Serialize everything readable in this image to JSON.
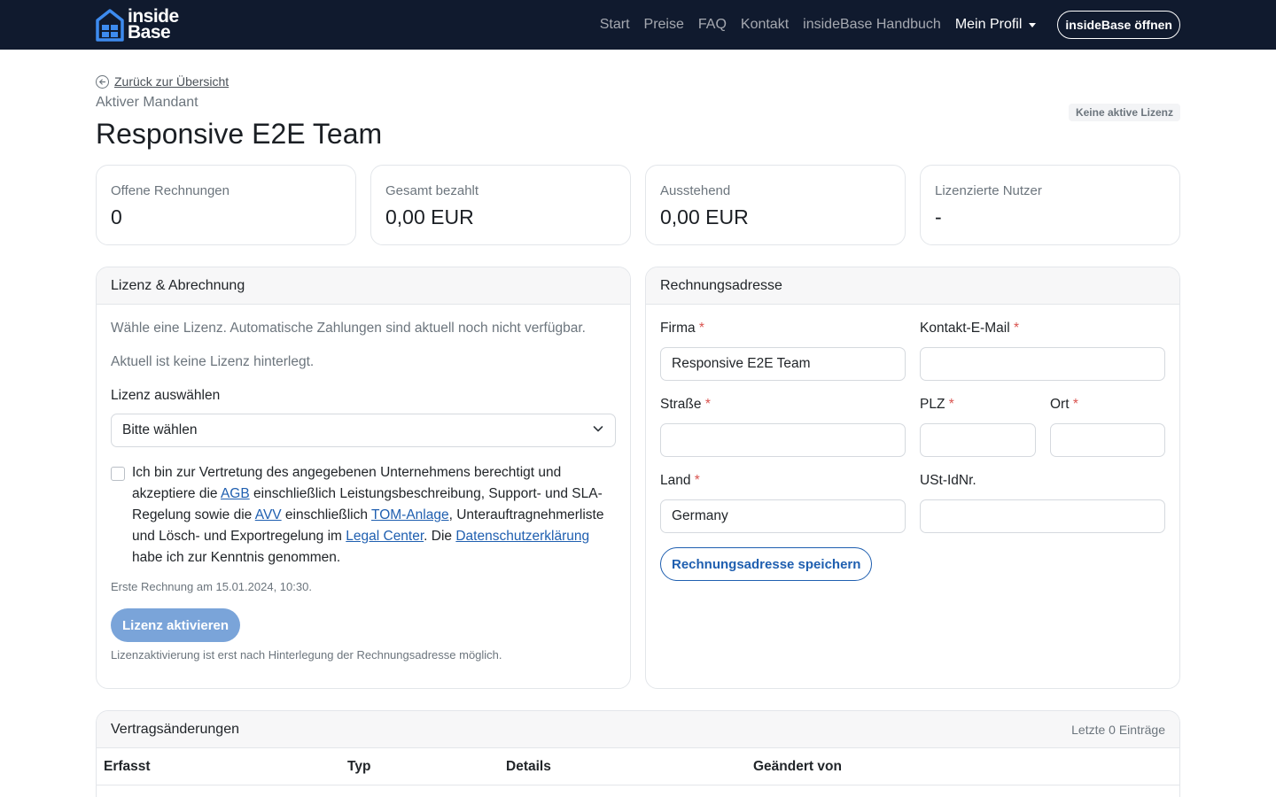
{
  "navbar": {
    "brand": {
      "line1": "inside",
      "line2": "Base"
    },
    "links": [
      "Start",
      "Preise",
      "FAQ",
      "Kontakt",
      "insideBase Handbuch"
    ],
    "profile_label": "Mein Profil",
    "open_button": "insideBase öffnen"
  },
  "header": {
    "back_link": "Zurück zur Übersicht",
    "subtitle": "Aktiver Mandant",
    "title": "Responsive E2E Team",
    "license_badge": "Keine aktive Lizenz"
  },
  "stats": [
    {
      "label": "Offene Rechnungen",
      "value": "0"
    },
    {
      "label": "Gesamt bezahlt",
      "value": "0,00 EUR"
    },
    {
      "label": "Ausstehend",
      "value": "0,00 EUR"
    },
    {
      "label": "Lizenzierte Nutzer",
      "value": "-"
    }
  ],
  "license": {
    "header": "Lizenz & Abrechnung",
    "intro": "Wähle eine Lizenz. Automatische Zahlungen sind aktuell noch nicht verfügbar.",
    "current": "Aktuell ist keine Lizenz hinterlegt.",
    "select_label": "Lizenz auswählen",
    "select_value": "Bitte wählen",
    "consent": {
      "t1": "Ich bin zur Vertretung des angegebenen Unternehmens berechtigt und akzeptiere die ",
      "agb": "AGB",
      "t2": " einschließlich Leistungsbeschreibung, Support- und SLA-Regelung sowie die ",
      "avv": "AVV",
      "t3": " einschließlich ",
      "tom": "TOM-Anlage",
      "t4": ", Unterauftragnehmerliste und Lösch- und Exportregelung im ",
      "legal": "Legal Center",
      "t5": ". Die ",
      "privacy": "Datenschutzerklärung",
      "t6": " habe ich zur Kenntnis genommen."
    },
    "first_invoice": "Erste Rechnung am 15.01.2024, 10:30.",
    "activate_button": "Lizenz aktivieren",
    "hint": "Lizenzaktivierung ist erst nach Hinterlegung der Rechnungsadresse möglich."
  },
  "address": {
    "header": "Rechnungsadresse",
    "required_mark": "*",
    "company_label": "Firma",
    "company_value": "Responsive E2E Team",
    "email_label": "Kontakt-E-Mail",
    "email_value": "",
    "street_label": "Straße",
    "street_value": "",
    "zip_label": "PLZ",
    "zip_value": "",
    "city_label": "Ort",
    "city_value": "",
    "country_label": "Land",
    "country_value": "Germany",
    "vat_label": "USt-IdNr.",
    "vat_value": "",
    "save_button": "Rechnungsadresse speichern"
  },
  "changes": {
    "header": "Vertragsänderungen",
    "meta": "Letzte 0 Einträge",
    "columns": [
      "Erfasst",
      "Typ",
      "Details",
      "Geändert von"
    ]
  }
}
